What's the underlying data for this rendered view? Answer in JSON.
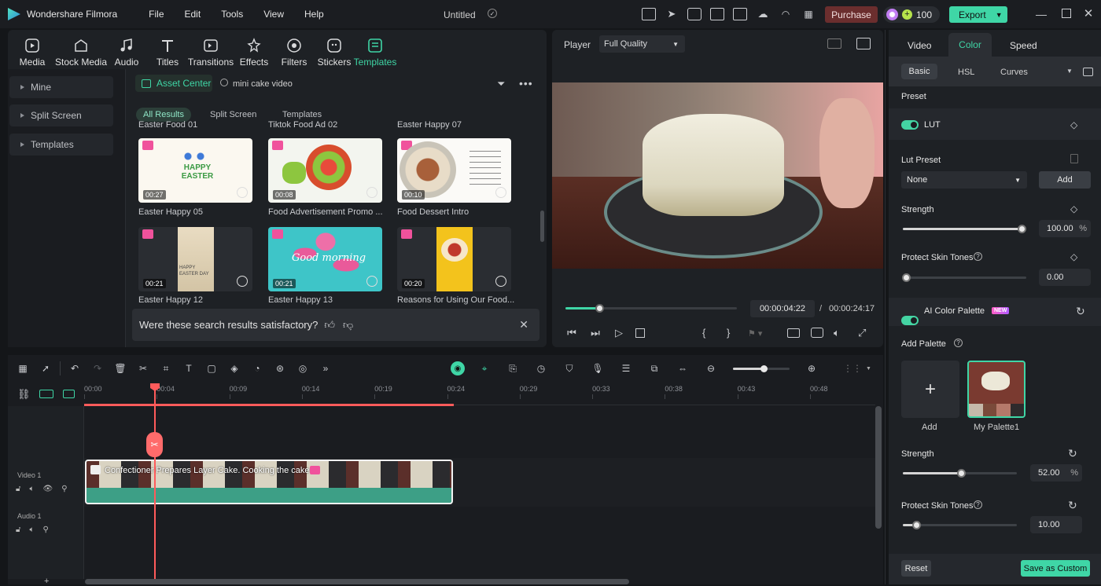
{
  "app": {
    "name": "Wondershare Filmora",
    "doc_title": "Untitled",
    "menu": [
      "File",
      "Edit",
      "Tools",
      "View",
      "Help"
    ],
    "purchase": "Purchase",
    "credits": "100",
    "export": "Export"
  },
  "media_tabs": [
    {
      "label": "Media",
      "icon": "media-icon"
    },
    {
      "label": "Stock Media",
      "icon": "stock-media-icon"
    },
    {
      "label": "Audio",
      "icon": "audio-icon"
    },
    {
      "label": "Titles",
      "icon": "titles-icon"
    },
    {
      "label": "Transitions",
      "icon": "transitions-icon"
    },
    {
      "label": "Effects",
      "icon": "effects-icon"
    },
    {
      "label": "Filters",
      "icon": "filters-icon"
    },
    {
      "label": "Stickers",
      "icon": "stickers-icon"
    },
    {
      "label": "Templates",
      "icon": "templates-icon"
    }
  ],
  "sidebar": {
    "items": [
      "Mine",
      "Split Screen",
      "Templates"
    ]
  },
  "browser": {
    "asset_center": "Asset Center",
    "search_value": "mini cake video",
    "filters": [
      "All Results",
      "Split Screen",
      "Templates"
    ],
    "top_labels": [
      "Easter Food 01",
      "Tiktok Food Ad 02",
      "Easter Happy 07"
    ],
    "row1": [
      {
        "label": "Easter Happy 05",
        "dur": "00:27"
      },
      {
        "label": "Food Advertisement Promo ...",
        "dur": "00:08"
      },
      {
        "label": "Food Dessert Intro",
        "dur": "00:10"
      }
    ],
    "row2": [
      {
        "label": "Easter Happy 12",
        "dur": "00:21"
      },
      {
        "label": "Easter Happy 13",
        "dur": "00:21"
      },
      {
        "label": "Reasons for Using Our Food...",
        "dur": "00:20"
      }
    ],
    "card_texts": {
      "happy_easter": "HAPPY EASTER",
      "good_morning": "Good morning",
      "easter_day": "HAPPY EASTER DAY"
    },
    "feedback": "Were these search results satisfactory?"
  },
  "player": {
    "label": "Player",
    "quality": "Full Quality",
    "current": "00:00:04:22",
    "separator": "/",
    "total": "00:00:24:17",
    "progress": 0.2
  },
  "right": {
    "tabs": [
      "Video",
      "Color",
      "Speed"
    ],
    "subtabs": [
      "Basic",
      "HSL",
      "Curves"
    ],
    "preset": "Preset",
    "lut": "LUT",
    "lut_preset": "Lut Preset",
    "lut_value": "None",
    "add": "Add",
    "strength": "Strength",
    "strength_value": "100.00",
    "percent": "%",
    "protect": "Protect Skin Tones",
    "protect_value": "0.00",
    "ai_palette": "AI Color Palette",
    "new_badge": "NEW",
    "add_palette": "Add Palette",
    "add_tile": "Add",
    "my_palette": "My Palette1",
    "strength2_value": "52.00",
    "protect2_value": "10.00",
    "reset": "Reset",
    "save_custom": "Save as Custom"
  },
  "timeline": {
    "ruler": [
      "00:00",
      "00:04",
      "00:09",
      "00:14",
      "00:19",
      "00:24",
      "00:29",
      "00:33",
      "00:38",
      "00:43",
      "00:48"
    ],
    "video_track": "Video 1",
    "audio_track": "Audio 1",
    "clip": "Confectioner Prepares Layer Cake. Cooking the cake"
  },
  "colors": {
    "accent": "#3fd6a6",
    "purchase": "#6b2e2e",
    "playhead": "#ff5b5b",
    "gem": "#f0529c"
  }
}
